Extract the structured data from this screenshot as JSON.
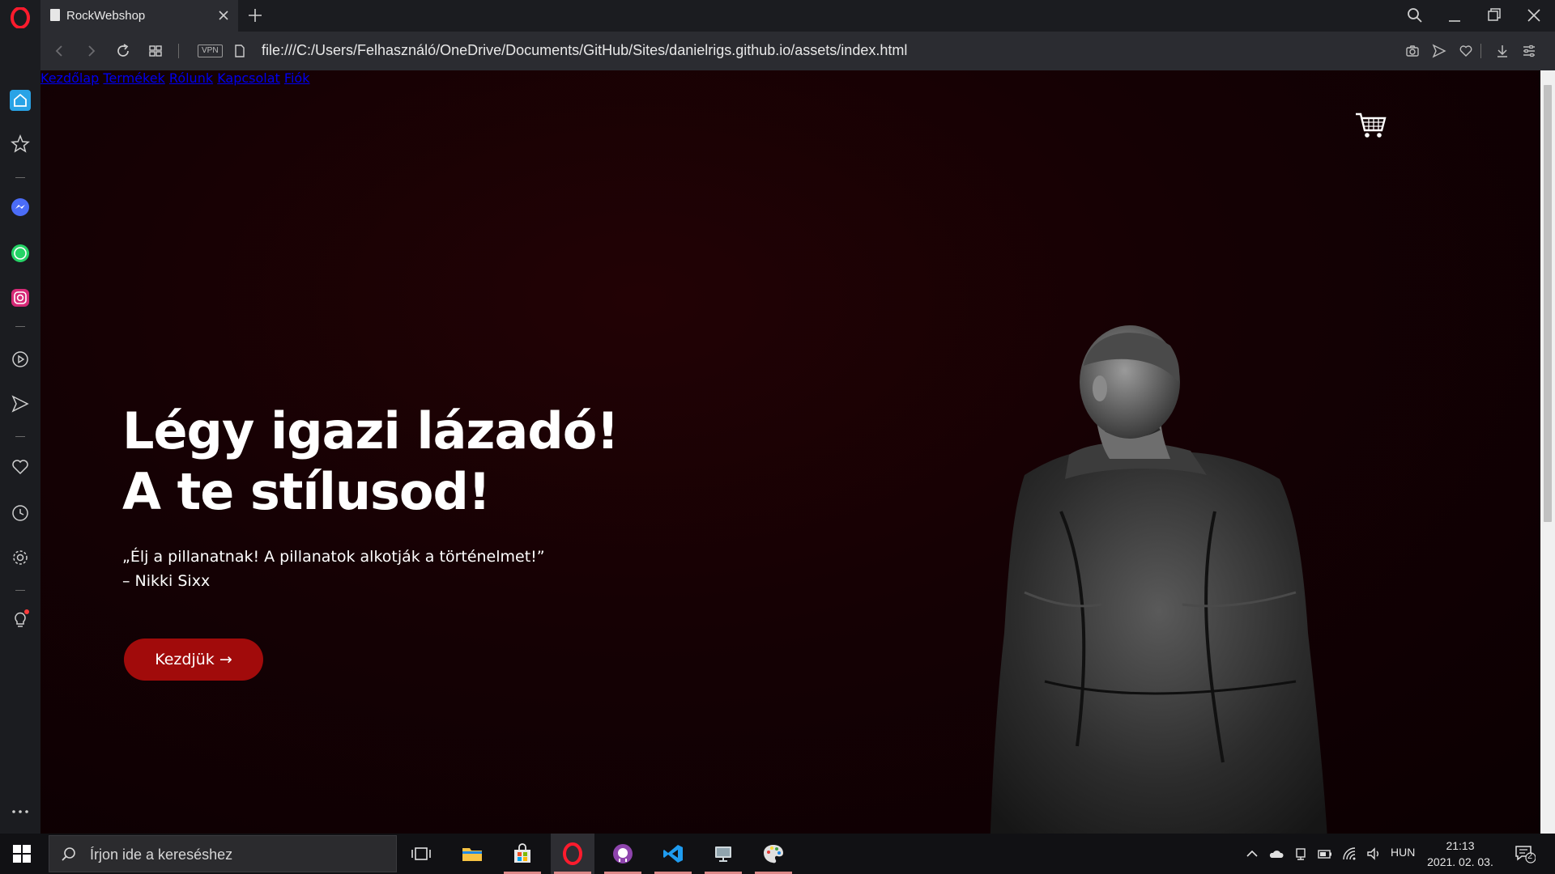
{
  "browser": {
    "tab_title": "RockWebshop",
    "url": "file:///C:/Users/Felhasználó/OneDrive/Documents/GitHub/Sites/danielrigs.github.io/assets/index.html",
    "vpn_label": "VPN"
  },
  "site": {
    "nav": [
      "Kezdőlap",
      "Termékek",
      "Rólunk",
      "Kapcsolat",
      "Fiók"
    ],
    "hero": {
      "title_line1": "Légy igazi lázadó!",
      "title_line2": "A te stílusod!",
      "quote": "„Élj a pillanatnak! A pillanatok alkotják a történelmet!”",
      "quote_author": "– Nikki Sixx",
      "cta_label": "Kezdjük →"
    },
    "accent_color": "#a10b0b"
  },
  "taskbar": {
    "search_placeholder": "Írjon ide a kereséshez",
    "language": "HUN",
    "time": "21:13",
    "date": "2021. 02. 03.",
    "notification_count": "2"
  }
}
